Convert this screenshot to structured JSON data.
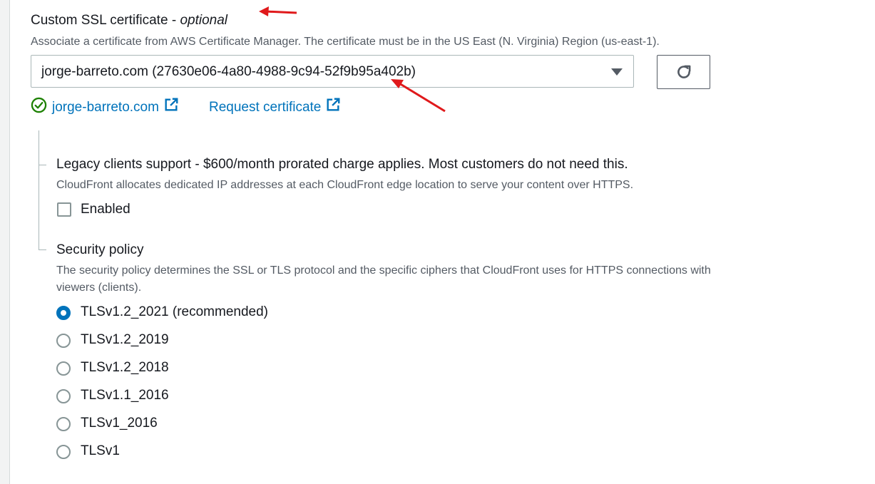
{
  "certificate": {
    "title": "Custom SSL certificate",
    "title_sep": " - ",
    "title_optional": "optional",
    "description": "Associate a certificate from AWS Certificate Manager. The certificate must be in the US East (N. Virginia) Region (us-east-1).",
    "selected_value": "jorge-barreto.com (27630e06-4a80-4988-9c94-52f9b95a402b)",
    "status_link": "jorge-barreto.com",
    "request_link": "Request certificate"
  },
  "legacy": {
    "title": "Legacy clients support - $600/month prorated charge applies. Most customers do not need this.",
    "description": "CloudFront allocates dedicated IP addresses at each CloudFront edge location to serve your content over HTTPS.",
    "checkbox_label": "Enabled",
    "checked": false
  },
  "security_policy": {
    "title": "Security policy",
    "description_line1": "The security policy determines the SSL or TLS protocol and the specific ciphers that CloudFront uses for HTTPS connections with",
    "description_line2": "viewers (clients).",
    "options": [
      {
        "label": "TLSv1.2_2021 (recommended)",
        "selected": true
      },
      {
        "label": "TLSv1.2_2019",
        "selected": false
      },
      {
        "label": "TLSv1.2_2018",
        "selected": false
      },
      {
        "label": "TLSv1.1_2016",
        "selected": false
      },
      {
        "label": "TLSv1_2016",
        "selected": false
      },
      {
        "label": "TLSv1",
        "selected": false
      }
    ]
  },
  "colors": {
    "link": "#0073bb",
    "success": "#1d8102",
    "annotation_arrow": "#e0191b"
  },
  "icons": {
    "status": "check-circle-icon",
    "external": "external-link-icon",
    "refresh": "refresh-icon",
    "dropdown": "caret-down-icon"
  }
}
